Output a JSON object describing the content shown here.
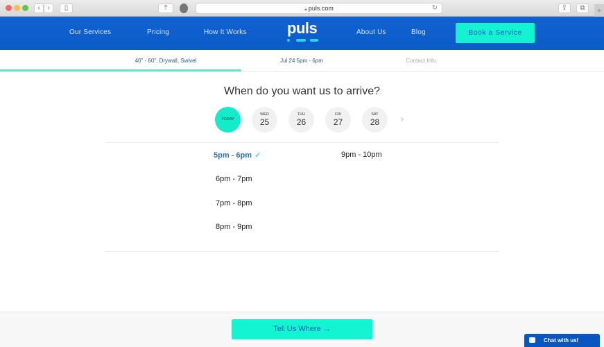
{
  "browser": {
    "url": "puls.com",
    "traffic_lights": [
      "#ed6a5e",
      "#f5bf4f",
      "#61c554"
    ]
  },
  "nav": {
    "logo": "puls",
    "links": [
      "Our Services",
      "Pricing",
      "How It Works",
      "About Us",
      "Blog"
    ],
    "cta": "Book a Service",
    "colors": {
      "bar": "#0d5fd0",
      "cta": "#14f2d2"
    }
  },
  "steps": [
    {
      "label": "40\" - 60\", Drywall, Swivel",
      "state": "completed"
    },
    {
      "label": "Jul 24 5pm - 6pm",
      "state": "current"
    },
    {
      "label": "Contact Info",
      "state": "upcoming"
    }
  ],
  "progress_percent": 40,
  "main": {
    "title": "When do you want us to arrive?",
    "days": [
      {
        "weekday": "TODAY",
        "date": "",
        "selected": true
      },
      {
        "weekday": "WED",
        "date": "25",
        "selected": false
      },
      {
        "weekday": "THU",
        "date": "26",
        "selected": false
      },
      {
        "weekday": "FRI",
        "date": "27",
        "selected": false
      },
      {
        "weekday": "SAT",
        "date": "28",
        "selected": false
      }
    ],
    "next_icon": "chevron-right-icon",
    "slots": [
      {
        "label": "5pm - 6pm",
        "selected": true
      },
      {
        "label": "6pm - 7pm",
        "selected": false
      },
      {
        "label": "7pm - 8pm",
        "selected": false
      },
      {
        "label": "8pm - 9pm",
        "selected": false
      },
      {
        "label": "9pm - 10pm",
        "selected": false
      }
    ],
    "check": "✓"
  },
  "footer": {
    "button": "Tell Us Where →"
  },
  "chat": {
    "label": "Chat with us!"
  }
}
